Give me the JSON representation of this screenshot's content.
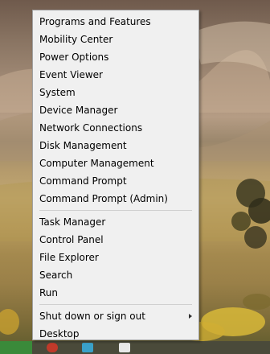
{
  "menu": {
    "group1": [
      {
        "label": "Programs and Features"
      },
      {
        "label": "Mobility Center"
      },
      {
        "label": "Power Options"
      },
      {
        "label": "Event Viewer"
      },
      {
        "label": "System"
      },
      {
        "label": "Device Manager"
      },
      {
        "label": "Network Connections"
      },
      {
        "label": "Disk Management"
      },
      {
        "label": "Computer Management"
      },
      {
        "label": "Command Prompt"
      },
      {
        "label": "Command Prompt (Admin)"
      }
    ],
    "group2": [
      {
        "label": "Task Manager"
      },
      {
        "label": "Control Panel"
      },
      {
        "label": "File Explorer"
      },
      {
        "label": "Search"
      },
      {
        "label": "Run"
      }
    ],
    "group3": [
      {
        "label": "Shut down or sign out"
      },
      {
        "label": "Desktop"
      }
    ]
  },
  "colors": {
    "menu_background": "#f0f0f0",
    "menu_border": "#a0a0a0",
    "menu_text": "#000000",
    "separator": "#d0d0d0"
  },
  "icons": {
    "submenu": "chevron-right-icon"
  }
}
